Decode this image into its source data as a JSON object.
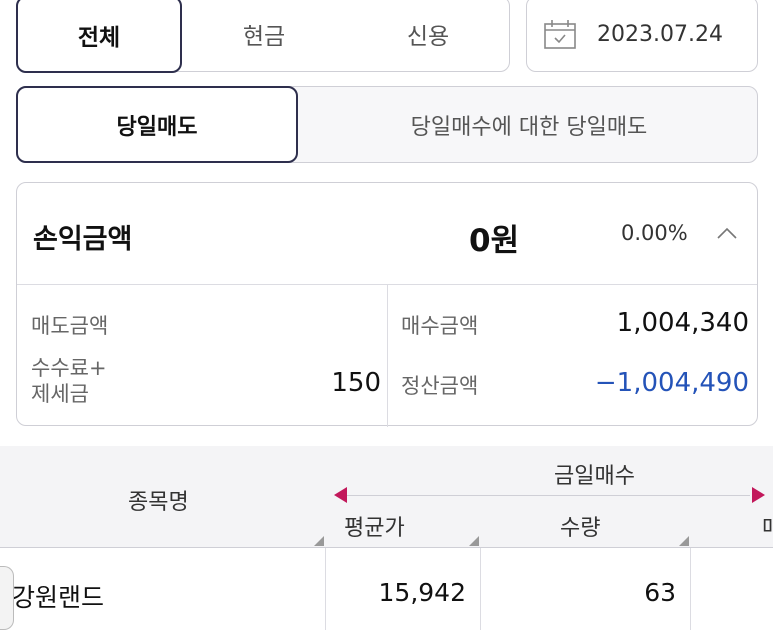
{
  "filter_tabs": [
    "전체",
    "현금",
    "신용"
  ],
  "date": {
    "value": "2023.07.24",
    "icon": "calendar-icon"
  },
  "sell_tabs": [
    "당일매도",
    "당일매수에 대한 당일매도"
  ],
  "summary": {
    "label": "손익금액",
    "amount": "0원",
    "rate": "0.00%",
    "collapse_icon": "chevron-up-icon",
    "sell_amount_label": "매도금액",
    "sell_amount_value": "",
    "fee_label_1": "수수료+",
    "fee_label_2": "제세금",
    "fee_value": "150",
    "buy_amount_label": "매수금액",
    "buy_amount_value": "1,004,340",
    "settle_label": "정산금액",
    "settle_value": "−1,004,490"
  },
  "table": {
    "col_name": "종목명",
    "group_label": "금일매수",
    "sub_cols": [
      "평균가",
      "수량",
      "매"
    ],
    "rows": [
      {
        "name": "강원랜드",
        "avg_price": "15,942",
        "qty": "63"
      }
    ]
  },
  "colors": {
    "accent": "#2e2f4d",
    "negative": "#2453b8",
    "scroll_arrow": "#c2185b"
  }
}
